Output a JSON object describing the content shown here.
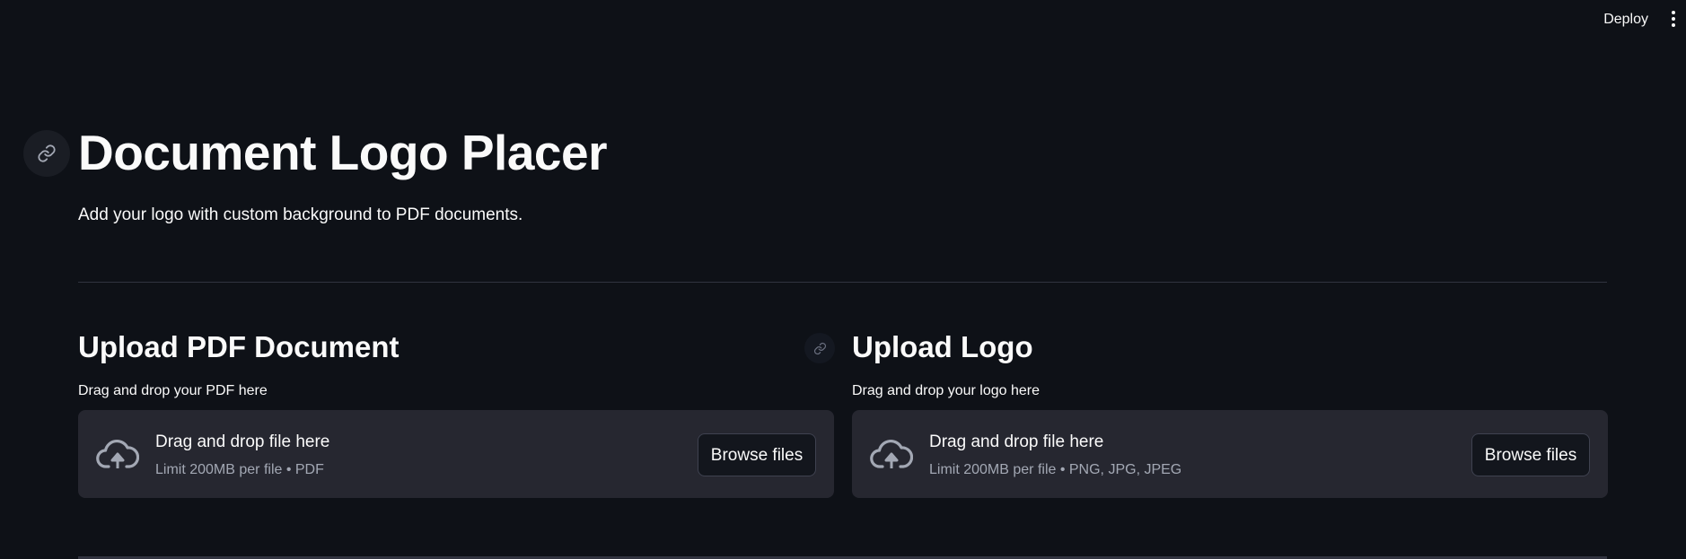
{
  "header": {
    "deploy_label": "Deploy"
  },
  "main": {
    "title": "Document Logo Placer",
    "subtitle": "Add your logo with custom background to PDF documents."
  },
  "uploaders": [
    {
      "heading": "Upload PDF Document",
      "label": "Drag and drop your PDF here",
      "dropzone_text": "Drag and drop file here",
      "limit_text": "Limit 200MB per file • PDF",
      "button_label": "Browse files"
    },
    {
      "heading": "Upload Logo",
      "label": "Drag and drop your logo here",
      "dropzone_text": "Drag and drop file here",
      "limit_text": "Limit 200MB per file • PNG, JPG, JPEG",
      "button_label": "Browse files"
    }
  ],
  "colors": {
    "background": "#0e1117",
    "dropzone": "#262730",
    "text": "#fafafa",
    "muted": "#a3a8b4"
  },
  "icons": {
    "anchor_link": "link-icon",
    "upload": "cloud-upload-icon",
    "menu": "more-vertical-icon"
  }
}
